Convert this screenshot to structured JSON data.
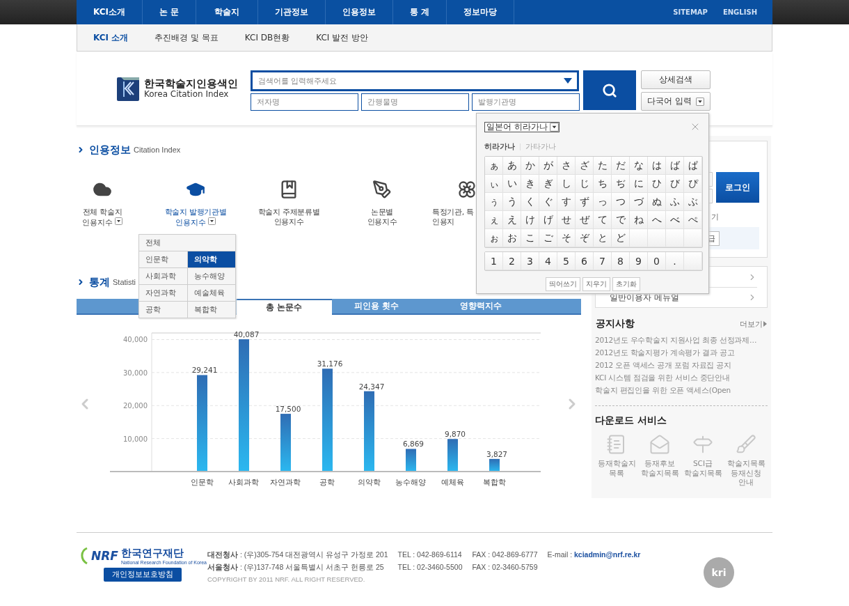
{
  "top_nav": {
    "items": [
      "KCI소개",
      "논 문",
      "학술지",
      "기관정보",
      "인용정보",
      "통 계",
      "정보마당"
    ],
    "links": [
      "SITEMAP",
      "ENGLISH"
    ]
  },
  "sub_nav": [
    {
      "label": "KCI 소개",
      "selected": true
    },
    {
      "label": "추진배경 및 목표",
      "selected": false
    },
    {
      "label": "KCI DB현황",
      "selected": false
    },
    {
      "label": "KCI 발전 방안",
      "selected": false
    }
  ],
  "logo": {
    "title": "한국학술지인용색인",
    "subtitle": "Korea Citation Index"
  },
  "search": {
    "placeholder": "검색어를 입력해주세요",
    "fields": [
      {
        "placeholder": "저자명"
      },
      {
        "placeholder": "간행물명"
      },
      {
        "placeholder": "발행기관명"
      }
    ],
    "detail_button": "상세검색",
    "multilang_button": "다국어 입력"
  },
  "citation": {
    "title": "인용정보",
    "subtitle": "Citation Index",
    "items": [
      {
        "kind": "cloud",
        "label": "전체 학술지\n인용지수",
        "dropdown": true,
        "selected": false
      },
      {
        "kind": "cap",
        "label": "학술지 발행기관별\n인용지수",
        "dropdown": true,
        "selected": true
      },
      {
        "kind": "book",
        "label": "학술지 주제분류별\n인용지수",
        "dropdown": false,
        "selected": false
      },
      {
        "kind": "pen",
        "label": "논문별\n인용지수",
        "dropdown": false,
        "selected": false
      },
      {
        "kind": "flower",
        "label": "특정기관, 특\n인용지",
        "dropdown": false,
        "selected": false
      }
    ]
  },
  "category_menu": {
    "all": "전체",
    "items": [
      {
        "label": "인문학",
        "selected": false
      },
      {
        "label": "의약학",
        "selected": true
      },
      {
        "label": "사회과학",
        "selected": false
      },
      {
        "label": "농수해양",
        "selected": false
      },
      {
        "label": "자연과학",
        "selected": false
      },
      {
        "label": "예술체육",
        "selected": false
      },
      {
        "label": "공학",
        "selected": false
      },
      {
        "label": "복합학",
        "selected": false
      }
    ]
  },
  "stats": {
    "title": "통계",
    "subtitle": "Statisti",
    "tabs": [
      {
        "label": "총 논문수",
        "selected": true
      },
      {
        "label": "피인용 횟수",
        "selected": false
      },
      {
        "label": "영향력지수",
        "selected": false
      }
    ],
    "chart_data": {
      "type": "bar",
      "categories": [
        "인문학",
        "사회과학",
        "자연과학",
        "공학",
        "의약학",
        "농수해양",
        "예체육",
        "복합학"
      ],
      "values": [
        29241,
        40087,
        17500,
        31176,
        24347,
        6869,
        9870,
        3827
      ],
      "grid": true,
      "ylim": [
        0,
        42000
      ],
      "yticks": [
        {
          "value": 10000,
          "label": "10,000"
        },
        {
          "value": 20000,
          "label": "20,000"
        },
        {
          "value": 30000,
          "label": "30,000"
        },
        {
          "value": 40000,
          "label": "40,000"
        }
      ],
      "value_labels": [
        "29,241",
        "40,087",
        "17,500",
        "31,176",
        "24,347",
        "6,869",
        "9,870",
        "3,827"
      ]
    }
  },
  "kana_popup": {
    "script": "일본어 히라가나",
    "tabs": [
      {
        "label": "히라가나",
        "selected": true
      },
      {
        "label": "가타가나",
        "selected": false
      }
    ],
    "rows": [
      [
        "ぁ",
        "あ",
        "か",
        "が",
        "さ",
        "ざ",
        "た",
        "だ",
        "な",
        "は",
        "ば",
        "ぱ"
      ],
      [
        "ぃ",
        "い",
        "き",
        "ぎ",
        "し",
        "じ",
        "ち",
        "ぢ",
        "に",
        "ひ",
        "び",
        "ぴ"
      ],
      [
        "ぅ",
        "う",
        "く",
        "ぐ",
        "す",
        "ず",
        "っ",
        "つ",
        "づ",
        "ぬ",
        "ふ",
        "ぶ"
      ],
      [
        "ぇ",
        "え",
        "け",
        "げ",
        "せ",
        "ぜ",
        "て",
        "で",
        "ね",
        "へ",
        "べ",
        "ぺ"
      ],
      [
        "ぉ",
        "お",
        "こ",
        "ご",
        "そ",
        "ぞ",
        "と",
        "ど"
      ]
    ],
    "number_row": [
      "1",
      "2",
      "3",
      "4",
      "5",
      "6",
      "7",
      "8",
      "9",
      "0",
      "."
    ],
    "buttons": [
      "띄어쓰기",
      "지우기",
      "초기화"
    ]
  },
  "login": {
    "button": "로그인",
    "link_fragment": "기",
    "button_fragment": "급"
  },
  "quick_links": {
    "visible_items": [
      "일반이용자 메뉴얼"
    ]
  },
  "notices": {
    "title": "공지사항",
    "more": "더보기",
    "items": [
      "2012년도 우수학술지 지원사업 최종 선정과제…",
      "2012년도 학술지평가 계속평가 결과 공고",
      "2012 오픈 액세스 공개 포럼 자료집 공지",
      "KCI 시스템 점검을 위한 서비스 중단안내",
      "학술지 편집인을 위한 오픈 액세스(Open"
    ]
  },
  "downloads": {
    "title": "다운로드 서비스",
    "items": [
      {
        "kind": "list",
        "label": "등재학술지\n목록"
      },
      {
        "kind": "mail",
        "label": "등재후보\n학술지목록"
      },
      {
        "kind": "sign",
        "label": "SCI급\n학술지목록"
      },
      {
        "kind": "brush",
        "label": "학술지목록\n등재신청\n안내"
      }
    ]
  },
  "footer": {
    "org_logo": {
      "mark": "NRF",
      "name": "한국연구재단",
      "english": "National Research Foundation of Korea"
    },
    "privacy_button": "개인정보보호방침",
    "offices": [
      {
        "address": "**대전청사** : (우)305-754 대전광역시 유성구 가정로 201",
        "tel": "TEL : 042-869-6114",
        "fax": "FAX : 042-869-6777"
      },
      {
        "address": "**서울청사** : (우)137-748 서울특별시 서초구 헌릉로 25",
        "tel": "TEL : 02-3460-5500",
        "fax": "FAX : 02-3460-5759"
      }
    ],
    "email_label": "E-mail :",
    "email": "kciadmin@nrf.re.kr",
    "copyright": "COPYRIGHT BY 2011 NRF. ALL RIGHT RESERVED.",
    "partner_logo": "kri"
  }
}
